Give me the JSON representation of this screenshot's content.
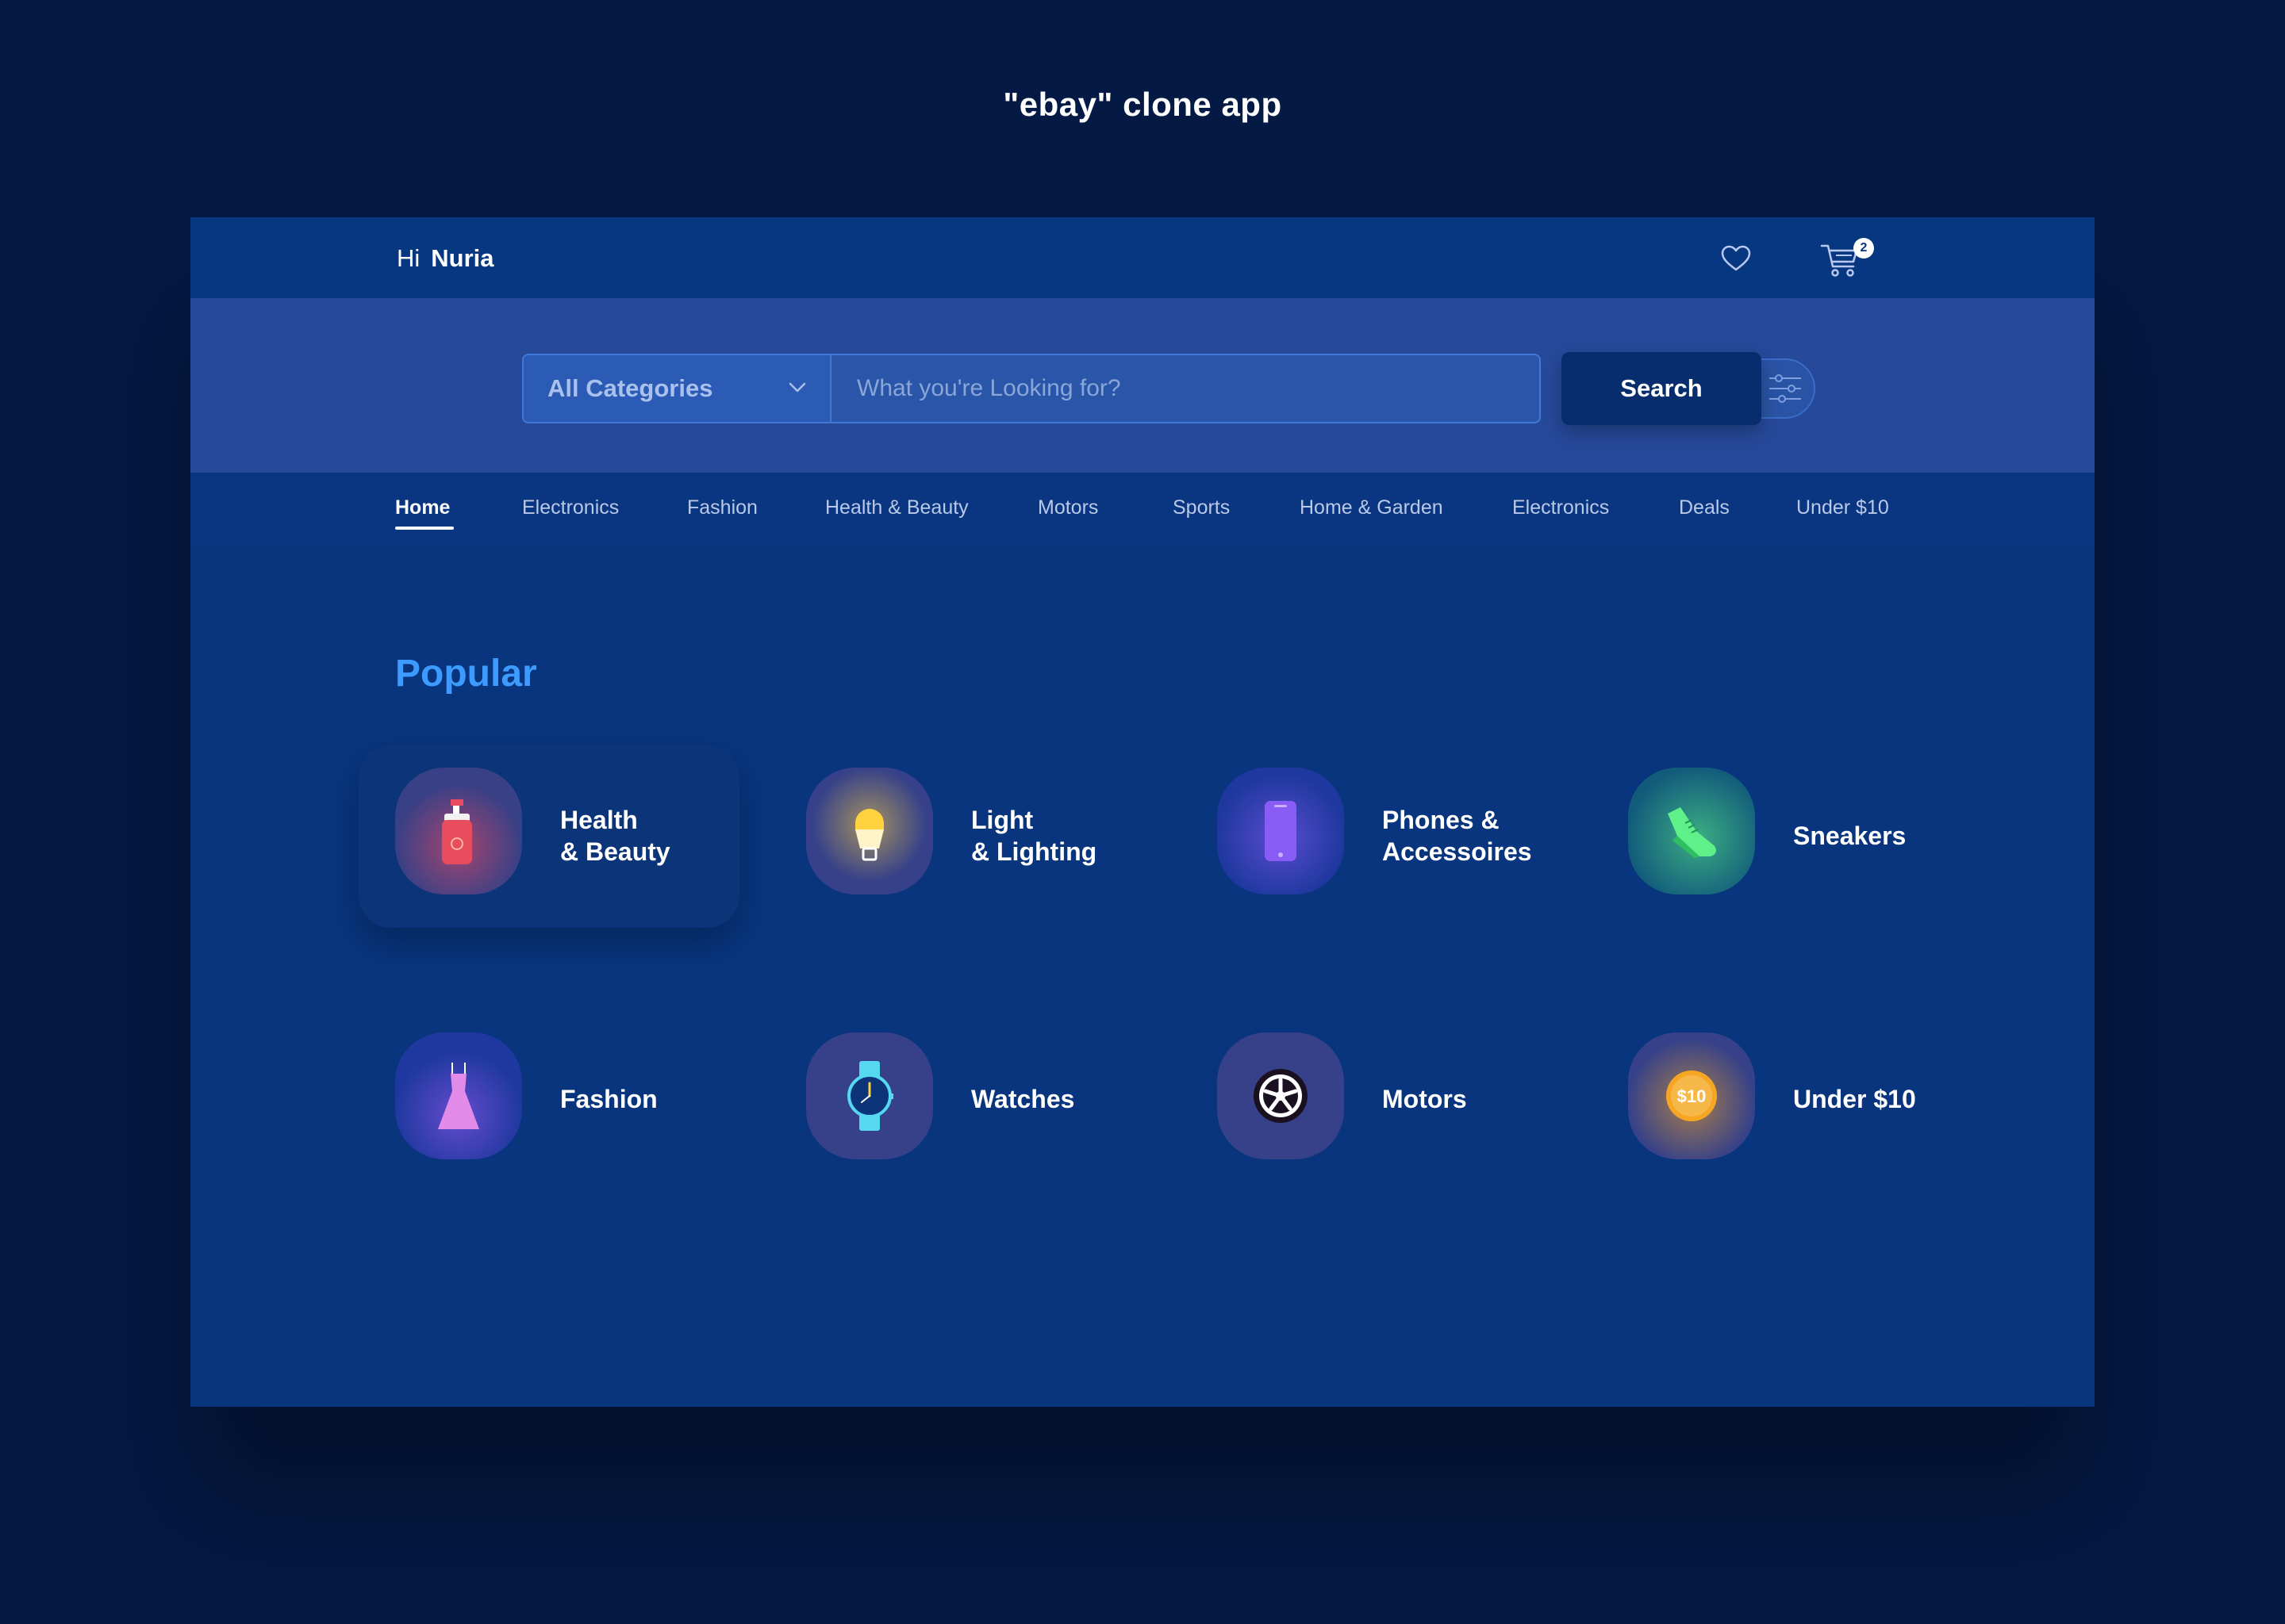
{
  "page": {
    "title": "\"ebay\" clone app"
  },
  "header": {
    "greeting_prefix": "Hi",
    "user_name": "Nuria",
    "cart_count": "2"
  },
  "search": {
    "category_label": "All Categories",
    "placeholder": "What you're Looking for?",
    "button_label": "Search"
  },
  "nav": {
    "items": [
      {
        "label": "Home"
      },
      {
        "label": "Electronics"
      },
      {
        "label": "Fashion"
      },
      {
        "label": "Health & Beauty"
      },
      {
        "label": "Motors"
      },
      {
        "label": "Sports"
      },
      {
        "label": "Home & Garden"
      },
      {
        "label": "Electronics"
      },
      {
        "label": "Deals"
      },
      {
        "label": "Under $10"
      }
    ]
  },
  "popular": {
    "title": "Popular",
    "categories": [
      {
        "line1": "Health",
        "line2": "& Beauty",
        "icon": "lotion-bottle-icon",
        "color": "#e84d5f"
      },
      {
        "line1": "Light",
        "line2": "& Lighting",
        "icon": "light-bulb-icon",
        "color": "#ffd23f"
      },
      {
        "line1": "Phones &",
        "line2": "Accessoires",
        "icon": "phone-icon",
        "color": "#8a5cf6"
      },
      {
        "line1": "Sneakers",
        "line2": "",
        "icon": "sneaker-icon",
        "color": "#5ff08a"
      },
      {
        "line1": "Fashion",
        "line2": "",
        "icon": "dress-icon",
        "color": "#e38be8"
      },
      {
        "line1": "Watches",
        "line2": "",
        "icon": "watch-icon",
        "color": "#56d9f0"
      },
      {
        "line1": "Motors",
        "line2": "",
        "icon": "wheel-icon",
        "color": "#ffffff"
      },
      {
        "line1": "Under $10",
        "line2": "",
        "icon": "coin-icon",
        "color": "#f5a623",
        "coin_text": "$10"
      }
    ]
  }
}
